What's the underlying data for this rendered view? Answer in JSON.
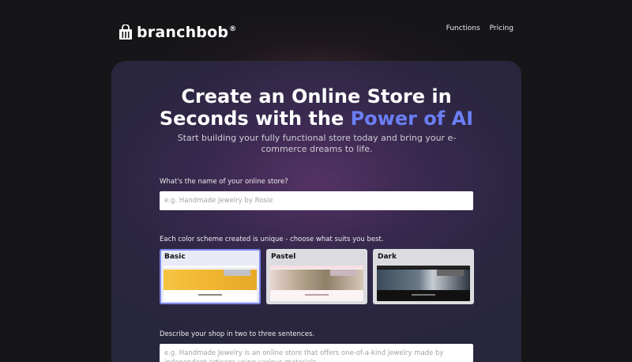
{
  "header": {
    "brand": "branchbob",
    "brand_mark": "®",
    "nav": [
      "Functions",
      "Pricing"
    ]
  },
  "hero": {
    "title_line1": "Create an Online Store in",
    "title_line2_prefix": "Seconds with the ",
    "title_line2_accent": "Power of AI",
    "subtitle": "Start building your fully functional store today and bring your e-commerce dreams to life."
  },
  "form": {
    "store_name_label": "What's the name of your online store?",
    "store_name_placeholder": "e.g. Handmade Jewelry by Rosie",
    "store_name_value": "",
    "scheme_label": "Each color scheme created is unique - choose what suits you best.",
    "schemes": [
      {
        "name": "Basic",
        "selected": true
      },
      {
        "name": "Pastel",
        "selected": false
      },
      {
        "name": "Dark",
        "selected": false
      }
    ],
    "description_label": "Describe your shop in two to three sentences.",
    "description_placeholder": "e.g. Handmade Jewelry is an online store that offers one-of-a-kind jewelry made by independent artisans using various materials."
  },
  "colors": {
    "accent": "#6a7ff5",
    "background": "#161619",
    "card": "#3e2c58"
  }
}
